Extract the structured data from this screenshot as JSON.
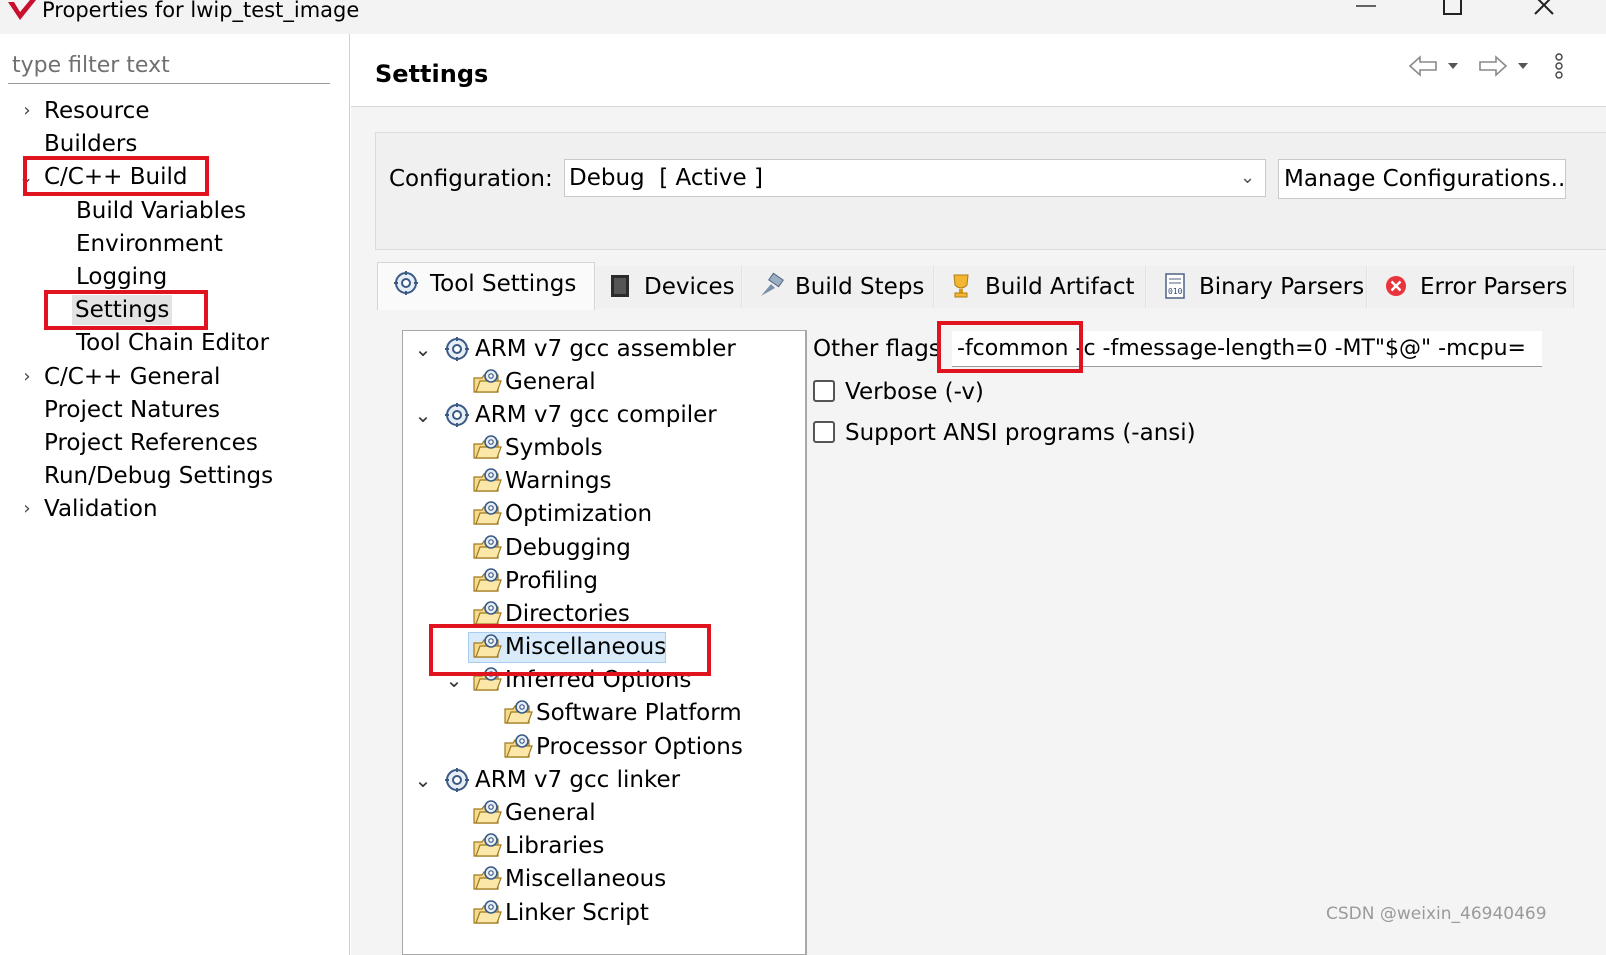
{
  "window": {
    "title": "Properties for lwip_test_image",
    "minimize_icon": "minimize-icon",
    "maximize_icon": "maximize-icon",
    "close_icon": "close-icon"
  },
  "filter": {
    "placeholder": "type filter text"
  },
  "nav": {
    "items": [
      {
        "label": "Resource",
        "expandable": true
      },
      {
        "label": "Builders"
      },
      {
        "label": "C/C++ Build",
        "expanded": true
      },
      {
        "label": "Build Variables"
      },
      {
        "label": "Environment"
      },
      {
        "label": "Logging"
      },
      {
        "label": "Settings",
        "selected": true
      },
      {
        "label": "Tool Chain Editor"
      },
      {
        "label": "C/C++ General",
        "expandable": true
      },
      {
        "label": "Project Natures"
      },
      {
        "label": "Project References"
      },
      {
        "label": "Run/Debug Settings"
      },
      {
        "label": "Validation",
        "expandable": true
      }
    ]
  },
  "header": {
    "title": "Settings",
    "icons": [
      "back-arrow-icon",
      "forward-arrow-icon",
      "more-icon"
    ]
  },
  "configuration": {
    "label": "Configuration:",
    "value": "Debug  [ Active ]",
    "manage_label": "Manage Configurations..."
  },
  "tabs": [
    {
      "label": "Tool Settings",
      "icon": "tool-settings-icon",
      "active": true
    },
    {
      "label": "Devices",
      "icon": "devices-icon"
    },
    {
      "label": "Build Steps",
      "icon": "build-steps-icon"
    },
    {
      "label": "Build Artifact",
      "icon": "trophy-icon"
    },
    {
      "label": "Binary Parsers",
      "icon": "binary-parser-icon"
    },
    {
      "label": "Error Parsers",
      "icon": "error-icon"
    }
  ],
  "tool_tree": [
    {
      "label": "ARM v7 gcc assembler"
    },
    {
      "label": "General"
    },
    {
      "label": "ARM v7 gcc compiler"
    },
    {
      "label": "Symbols"
    },
    {
      "label": "Warnings"
    },
    {
      "label": "Optimization"
    },
    {
      "label": "Debugging"
    },
    {
      "label": "Profiling"
    },
    {
      "label": "Directories"
    },
    {
      "label": "Miscellaneous",
      "selected": true
    },
    {
      "label": "Inferred Options"
    },
    {
      "label": "Software Platform"
    },
    {
      "label": "Processor Options"
    },
    {
      "label": "ARM v7 gcc linker"
    },
    {
      "label": "General"
    },
    {
      "label": "Libraries"
    },
    {
      "label": "Miscellaneous"
    },
    {
      "label": "Linker Script"
    }
  ],
  "options": {
    "other_flags_label": "Other flags",
    "other_flags_highlight": "-fcommon",
    "other_flags_rest": " -c -fmessage-length=0 -MT\"$@\" -mcpu=",
    "verbose_label": "Verbose (-v)",
    "verbose_checked": false,
    "ansi_label": "Support ANSI programs (-ansi)",
    "ansi_checked": false
  },
  "watermark": "CSDN @weixin_46940469",
  "colors": {
    "annotation_red": "#e0141e",
    "selection_blue": "#d9ebfa"
  }
}
